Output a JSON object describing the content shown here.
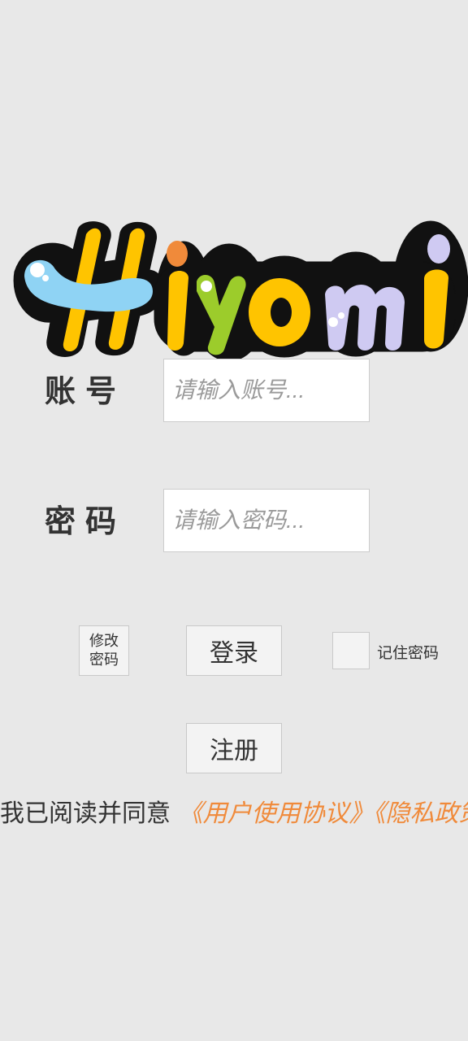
{
  "logo": {
    "text": "Hiyomi",
    "colors": {
      "outline": "#111111",
      "h": "#ffc400",
      "h_bar": "#8fd3f4",
      "i": "#ffc400",
      "i_dot": "#f08a3a",
      "y": "#9ccc2b",
      "o": "#ffc400",
      "m": "#cfcaf2",
      "i2": "#ffc400",
      "i2_dot": "#cfcaf2"
    }
  },
  "account": {
    "label": "账号",
    "placeholder": "请输入账号..."
  },
  "password": {
    "label": "密码",
    "placeholder": "请输入密码..."
  },
  "actions": {
    "change_password": "修改\n密码",
    "login": "登录",
    "remember_label": "记住密码",
    "remember_checked": false,
    "register": "注册"
  },
  "agreement": {
    "prefix": "我已阅读并同意",
    "user_agreement": "《用户使用协议》",
    "privacy_policy": "《隐私政策》"
  }
}
